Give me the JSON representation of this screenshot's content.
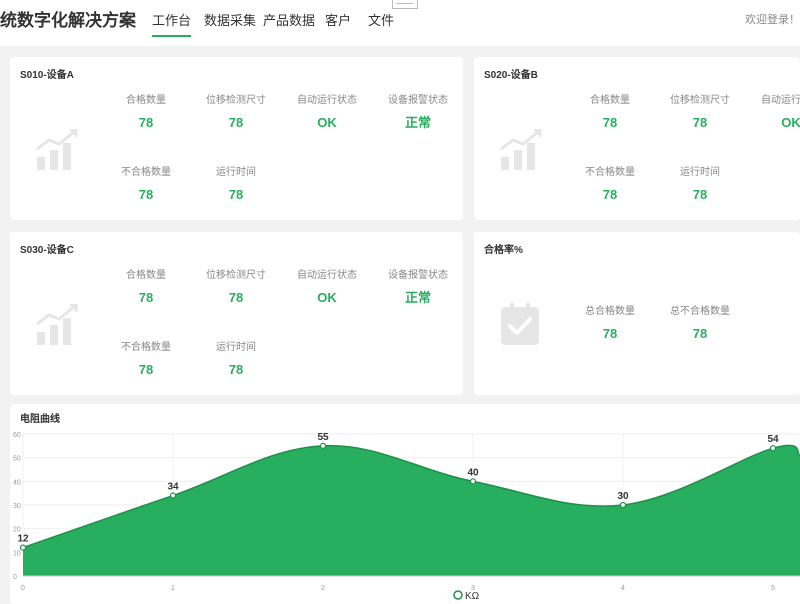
{
  "header": {
    "app_title": "统数字化解决方案",
    "nav": [
      {
        "label": "工作台",
        "active": true
      },
      {
        "label": "数据采集",
        "active": false
      },
      {
        "label": "产品数据",
        "active": false
      },
      {
        "label": "客户",
        "active": false
      },
      {
        "label": "文件",
        "active": false
      }
    ],
    "welcome": "欢迎登录！"
  },
  "devices": [
    {
      "title": "S010-设备A",
      "icon": "trend-bar-chart-icon",
      "metrics": [
        {
          "label": "合格数量",
          "value": "78"
        },
        {
          "label": "位移检测尺寸",
          "value": "78"
        },
        {
          "label": "自动运行状态",
          "value": "OK"
        },
        {
          "label": "设备报警状态",
          "value": "正常"
        },
        {
          "label": "不合格数量",
          "value": "78"
        },
        {
          "label": "运行时间",
          "value": "78"
        }
      ]
    },
    {
      "title": "S020-设备B",
      "icon": "trend-bar-chart-icon",
      "metrics": [
        {
          "label": "合格数量",
          "value": "78"
        },
        {
          "label": "位移检测尺寸",
          "value": "78"
        },
        {
          "label": "自动运行状态",
          "value": "OK"
        },
        {
          "label": "不合格数量",
          "value": "78"
        },
        {
          "label": "运行时间",
          "value": "78"
        }
      ]
    },
    {
      "title": "S030-设备C",
      "icon": "trend-bar-chart-icon",
      "metrics": [
        {
          "label": "合格数量",
          "value": "78"
        },
        {
          "label": "位移检测尺寸",
          "value": "78"
        },
        {
          "label": "自动运行状态",
          "value": "OK"
        },
        {
          "label": "设备报警状态",
          "value": "正常"
        },
        {
          "label": "不合格数量",
          "value": "78"
        },
        {
          "label": "运行时间",
          "value": "78"
        }
      ]
    }
  ],
  "pass_rate": {
    "title": "合格率%",
    "icon": "calendar-check-icon",
    "metrics": [
      {
        "label": "总合格数量",
        "value": "78"
      },
      {
        "label": "总不合格数量",
        "value": "78"
      }
    ]
  },
  "colors": {
    "accent": "#27ae5f",
    "area_fill": "#27ae5f",
    "line": "#1e8f4a",
    "icon_grey": "#e6e6e6"
  },
  "chart_data": {
    "type": "area",
    "title": "电阻曲线",
    "x": [
      0,
      1,
      2,
      3,
      4,
      5
    ],
    "series": [
      {
        "name": "KΩ",
        "values": [
          12,
          34,
          55,
          40,
          30,
          54
        ]
      }
    ],
    "ylim": [
      0,
      60
    ],
    "yticks": [
      0,
      10,
      20,
      30,
      40,
      50,
      60
    ],
    "xticks": [
      "0",
      "1",
      "2",
      "3",
      "4",
      "5"
    ],
    "grid": true,
    "legend": "bottom-center",
    "smooth": true
  }
}
